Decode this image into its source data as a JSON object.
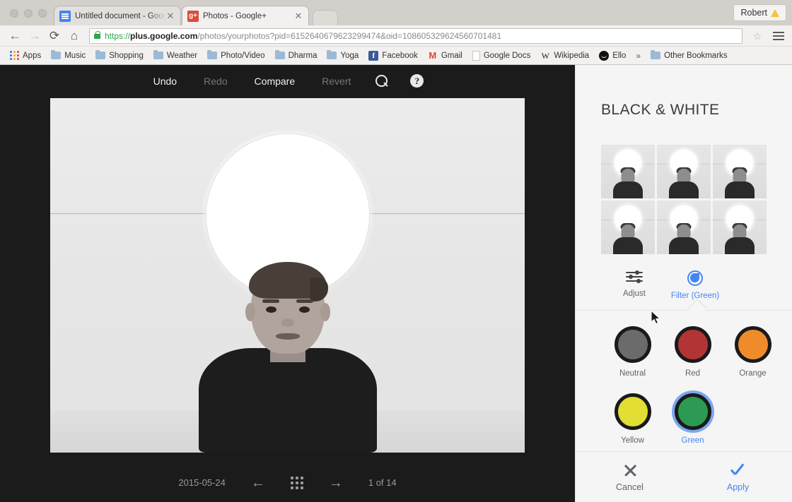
{
  "browser": {
    "window_dots": 3,
    "tabs": [
      {
        "title": "Untitled document - Goog",
        "favicon": "google-docs-icon",
        "favicon_text": "",
        "active": false
      },
      {
        "title": "Photos - Google+",
        "favicon": "google-plus-icon",
        "favicon_text": "g+",
        "active": true
      }
    ],
    "user_chip": {
      "label": "Robert",
      "icon": "warning-triangle-icon"
    },
    "nav": {
      "back": "←",
      "forward": "→",
      "reload": "⟳",
      "home": "⌂",
      "star": "☆",
      "menu": "hamburger-menu-icon"
    },
    "omnibox": {
      "scheme": "https://",
      "host": "plus.google.com",
      "path": "/photos/yourphotos?pid=6152640679623299474&oid=108605329624560701481",
      "full_url": "https://plus.google.com/photos/yourphotos?pid=6152640679623299474&oid=108605329624560701481",
      "secure_icon": "lock-icon"
    },
    "bookmarks": [
      {
        "label": "Apps",
        "icon": "apps-grid-icon"
      },
      {
        "label": "Music",
        "icon": "folder-icon"
      },
      {
        "label": "Shopping",
        "icon": "folder-icon"
      },
      {
        "label": "Weather",
        "icon": "folder-icon"
      },
      {
        "label": "Photo/Video",
        "icon": "folder-icon"
      },
      {
        "label": "Dharma",
        "icon": "folder-icon"
      },
      {
        "label": "Yoga",
        "icon": "folder-icon"
      },
      {
        "label": "Facebook",
        "icon": "facebook-icon"
      },
      {
        "label": "Gmail",
        "icon": "gmail-icon"
      },
      {
        "label": "Google Docs",
        "icon": "document-icon"
      },
      {
        "label": "Wikipedia",
        "icon": "wikipedia-icon"
      },
      {
        "label": "Ello",
        "icon": "ello-icon"
      }
    ],
    "bookmarks_overflow": "»",
    "other_bookmarks": {
      "label": "Other Bookmarks",
      "icon": "folder-icon"
    }
  },
  "editor": {
    "toolbar": {
      "undo": "Undo",
      "redo": "Redo",
      "compare": "Compare",
      "revert": "Revert",
      "zoom_icon": "magnifier-plus-icon",
      "help_icon": "help-circle-icon",
      "help_glyph": "?"
    },
    "bottom_bar": {
      "date": "2015-05-24",
      "prev_icon": "arrow-left-icon",
      "grid_icon": "grid-view-icon",
      "next_icon": "arrow-right-icon",
      "counter": "1 of 14",
      "prev_glyph": "←",
      "next_glyph": "→"
    },
    "photo": {
      "description": "black-and-white portrait of a boy in a dark t-shirt with a bright white circular light above"
    }
  },
  "panel": {
    "title": "BLACK & WHITE",
    "presets": [
      {
        "name": "preset-1",
        "selected": false
      },
      {
        "name": "preset-2",
        "selected": false
      },
      {
        "name": "preset-3",
        "selected": false
      },
      {
        "name": "preset-4",
        "selected": false
      },
      {
        "name": "preset-5",
        "selected": false
      },
      {
        "name": "preset-6",
        "selected": false
      }
    ],
    "mode_tabs": [
      {
        "label": "Adjust",
        "icon": "sliders-icon",
        "active": false
      },
      {
        "label": "Filter (Green)",
        "icon": "filter-circle-icon",
        "active": true
      }
    ],
    "filters": [
      {
        "label": "Neutral",
        "color": "#6b6b6b",
        "selected": false
      },
      {
        "label": "Red",
        "color": "#b23434",
        "selected": false
      },
      {
        "label": "Orange",
        "color": "#f08b2c",
        "selected": false
      },
      {
        "label": "Yellow",
        "color": "#e3de33",
        "selected": false
      },
      {
        "label": "Green",
        "color": "#2c9a52",
        "selected": true
      }
    ],
    "footer": {
      "cancel": "Cancel",
      "apply": "Apply",
      "cancel_icon": "close-x-icon",
      "apply_icon": "checkmark-icon"
    },
    "accent_color": "#4285f4"
  }
}
